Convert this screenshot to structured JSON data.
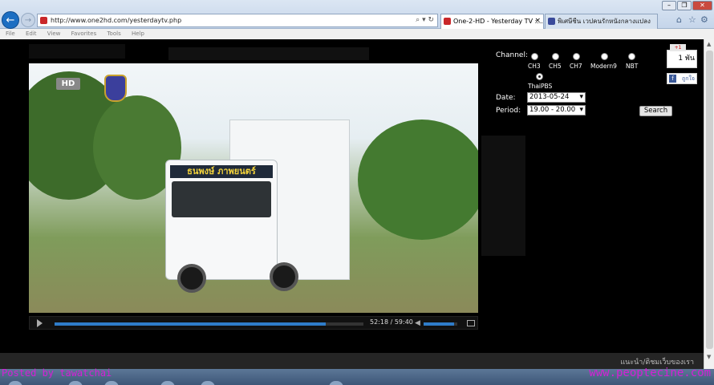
{
  "browser": {
    "url": "http://www.one2hd.com/yesterdaytv.php",
    "tabs": [
      {
        "label": "One-2-HD - Yesterday TV :...",
        "close": "×"
      },
      {
        "label": "พิเศษีชีน เวปคนรักหนังกลางแปลง"
      }
    ],
    "window_buttons": [
      "–",
      "❐",
      "✕"
    ],
    "menu": [
      "File",
      "Edit",
      "View",
      "Favorites",
      "Tools",
      "Help"
    ]
  },
  "player": {
    "overlay_badge": "HD",
    "truck_banner": "ธนพงษ์ ภาพยนตร์",
    "time": "52:18 / 59:40",
    "progress": 0.877,
    "volume": 0.9
  },
  "form": {
    "channel_label": "Channel:",
    "channels": [
      "CH3",
      "CH5",
      "CH7",
      "Modern9",
      "NBT",
      "ThaiPBS"
    ],
    "selected_channel": "ThaiPBS",
    "date_label": "Date:",
    "date_value": "2013-05-24",
    "period_label": "Period:",
    "period_value": "19.00 - 20.00",
    "search_button": "Search"
  },
  "social": {
    "like_plus": "+1",
    "like_count": "1 พัน",
    "fb_label": "ถูกใจ"
  },
  "footer": {
    "link": "แนะนำ/ติชมเว็บของเรา"
  },
  "watermarks": {
    "left": "Posted by tawatchai",
    "right": "www.peoptecine.com"
  },
  "colors": {
    "accent": "#2f7cc9",
    "watermark": "#d51fd6"
  }
}
